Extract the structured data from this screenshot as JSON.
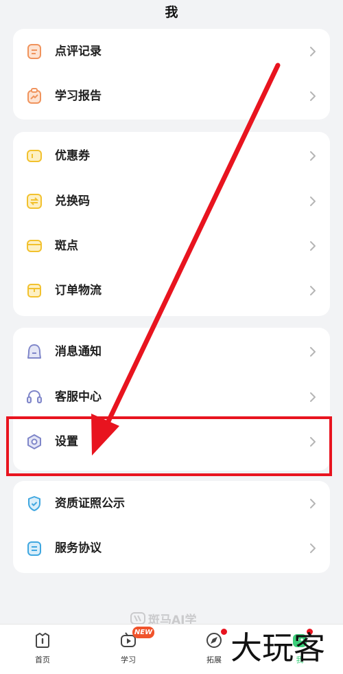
{
  "header": {
    "title": "我"
  },
  "group1": {
    "items": [
      {
        "label": "点评记录",
        "icon": "review-record-icon",
        "color": "#f0935c"
      },
      {
        "label": "学习报告",
        "icon": "study-report-icon",
        "color": "#f0935c"
      }
    ]
  },
  "group2": {
    "items": [
      {
        "label": "优惠券",
        "icon": "coupon-icon",
        "color": "#f2c12e"
      },
      {
        "label": "兑换码",
        "icon": "redeem-code-icon",
        "color": "#f2c12e"
      },
      {
        "label": "斑点",
        "icon": "spot-points-icon",
        "color": "#f2c12e"
      },
      {
        "label": "订单物流",
        "icon": "order-logistics-icon",
        "color": "#f2c12e"
      }
    ]
  },
  "group3": {
    "items": [
      {
        "label": "消息通知",
        "icon": "message-notification-icon",
        "color": "#7f86c9"
      },
      {
        "label": "客服中心",
        "icon": "customer-service-icon",
        "color": "#7f86c9"
      },
      {
        "label": "设置",
        "icon": "settings-icon",
        "color": "#7f86c9"
      }
    ]
  },
  "group4": {
    "items": [
      {
        "label": "资质证照公示",
        "icon": "qualification-icon",
        "color": "#3fa7e0"
      },
      {
        "label": "服务协议",
        "icon": "service-agreement-icon",
        "color": "#3fa7e0"
      }
    ]
  },
  "watermark": {
    "brand": "斑马AI学",
    "corner": "大玩客"
  },
  "tabbar": {
    "tabs": [
      {
        "label": "首页",
        "icon": "home-icon"
      },
      {
        "label": "学习",
        "icon": "study-tv-icon",
        "badge": "NEW"
      },
      {
        "label": "拓展",
        "icon": "explore-compass-icon"
      },
      {
        "label": "我",
        "icon": "profile-icon"
      }
    ]
  },
  "annotation": {
    "highlight_color": "#e8141f",
    "target": "设置"
  }
}
